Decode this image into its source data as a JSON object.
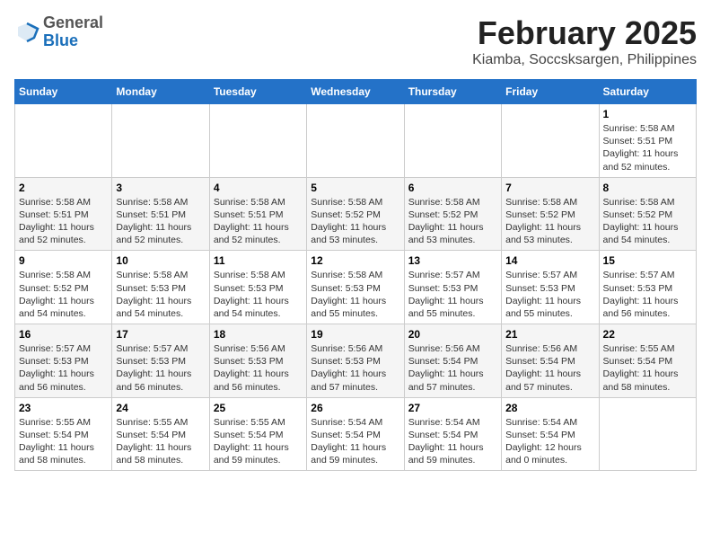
{
  "header": {
    "logo_general": "General",
    "logo_blue": "Blue",
    "title": "February 2025",
    "subtitle": "Kiamba, Soccsksargen, Philippines"
  },
  "days_of_week": [
    "Sunday",
    "Monday",
    "Tuesday",
    "Wednesday",
    "Thursday",
    "Friday",
    "Saturday"
  ],
  "weeks": [
    [
      {
        "day": "",
        "info": ""
      },
      {
        "day": "",
        "info": ""
      },
      {
        "day": "",
        "info": ""
      },
      {
        "day": "",
        "info": ""
      },
      {
        "day": "",
        "info": ""
      },
      {
        "day": "",
        "info": ""
      },
      {
        "day": "1",
        "info": "Sunrise: 5:58 AM\nSunset: 5:51 PM\nDaylight: 11 hours\nand 52 minutes."
      }
    ],
    [
      {
        "day": "2",
        "info": "Sunrise: 5:58 AM\nSunset: 5:51 PM\nDaylight: 11 hours\nand 52 minutes."
      },
      {
        "day": "3",
        "info": "Sunrise: 5:58 AM\nSunset: 5:51 PM\nDaylight: 11 hours\nand 52 minutes."
      },
      {
        "day": "4",
        "info": "Sunrise: 5:58 AM\nSunset: 5:51 PM\nDaylight: 11 hours\nand 52 minutes."
      },
      {
        "day": "5",
        "info": "Sunrise: 5:58 AM\nSunset: 5:52 PM\nDaylight: 11 hours\nand 53 minutes."
      },
      {
        "day": "6",
        "info": "Sunrise: 5:58 AM\nSunset: 5:52 PM\nDaylight: 11 hours\nand 53 minutes."
      },
      {
        "day": "7",
        "info": "Sunrise: 5:58 AM\nSunset: 5:52 PM\nDaylight: 11 hours\nand 53 minutes."
      },
      {
        "day": "8",
        "info": "Sunrise: 5:58 AM\nSunset: 5:52 PM\nDaylight: 11 hours\nand 54 minutes."
      }
    ],
    [
      {
        "day": "9",
        "info": "Sunrise: 5:58 AM\nSunset: 5:52 PM\nDaylight: 11 hours\nand 54 minutes."
      },
      {
        "day": "10",
        "info": "Sunrise: 5:58 AM\nSunset: 5:53 PM\nDaylight: 11 hours\nand 54 minutes."
      },
      {
        "day": "11",
        "info": "Sunrise: 5:58 AM\nSunset: 5:53 PM\nDaylight: 11 hours\nand 54 minutes."
      },
      {
        "day": "12",
        "info": "Sunrise: 5:58 AM\nSunset: 5:53 PM\nDaylight: 11 hours\nand 55 minutes."
      },
      {
        "day": "13",
        "info": "Sunrise: 5:57 AM\nSunset: 5:53 PM\nDaylight: 11 hours\nand 55 minutes."
      },
      {
        "day": "14",
        "info": "Sunrise: 5:57 AM\nSunset: 5:53 PM\nDaylight: 11 hours\nand 55 minutes."
      },
      {
        "day": "15",
        "info": "Sunrise: 5:57 AM\nSunset: 5:53 PM\nDaylight: 11 hours\nand 56 minutes."
      }
    ],
    [
      {
        "day": "16",
        "info": "Sunrise: 5:57 AM\nSunset: 5:53 PM\nDaylight: 11 hours\nand 56 minutes."
      },
      {
        "day": "17",
        "info": "Sunrise: 5:57 AM\nSunset: 5:53 PM\nDaylight: 11 hours\nand 56 minutes."
      },
      {
        "day": "18",
        "info": "Sunrise: 5:56 AM\nSunset: 5:53 PM\nDaylight: 11 hours\nand 56 minutes."
      },
      {
        "day": "19",
        "info": "Sunrise: 5:56 AM\nSunset: 5:53 PM\nDaylight: 11 hours\nand 57 minutes."
      },
      {
        "day": "20",
        "info": "Sunrise: 5:56 AM\nSunset: 5:54 PM\nDaylight: 11 hours\nand 57 minutes."
      },
      {
        "day": "21",
        "info": "Sunrise: 5:56 AM\nSunset: 5:54 PM\nDaylight: 11 hours\nand 57 minutes."
      },
      {
        "day": "22",
        "info": "Sunrise: 5:55 AM\nSunset: 5:54 PM\nDaylight: 11 hours\nand 58 minutes."
      }
    ],
    [
      {
        "day": "23",
        "info": "Sunrise: 5:55 AM\nSunset: 5:54 PM\nDaylight: 11 hours\nand 58 minutes."
      },
      {
        "day": "24",
        "info": "Sunrise: 5:55 AM\nSunset: 5:54 PM\nDaylight: 11 hours\nand 58 minutes."
      },
      {
        "day": "25",
        "info": "Sunrise: 5:55 AM\nSunset: 5:54 PM\nDaylight: 11 hours\nand 59 minutes."
      },
      {
        "day": "26",
        "info": "Sunrise: 5:54 AM\nSunset: 5:54 PM\nDaylight: 11 hours\nand 59 minutes."
      },
      {
        "day": "27",
        "info": "Sunrise: 5:54 AM\nSunset: 5:54 PM\nDaylight: 11 hours\nand 59 minutes."
      },
      {
        "day": "28",
        "info": "Sunrise: 5:54 AM\nSunset: 5:54 PM\nDaylight: 12 hours\nand 0 minutes."
      },
      {
        "day": "",
        "info": ""
      }
    ]
  ]
}
